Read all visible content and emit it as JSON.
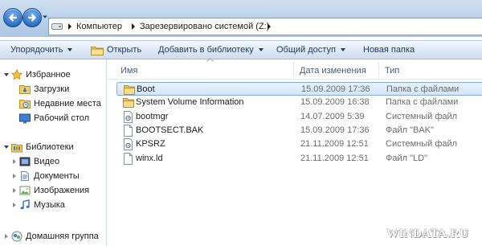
{
  "address_bar": {
    "crumbs": [
      "Компьютер",
      "Зарезервировано системой (Z:)"
    ]
  },
  "toolbar": {
    "organize": "Упорядочить",
    "open": "Открыть",
    "add_to_library": "Добавить в библиотеку",
    "share": "Общий доступ",
    "new_folder": "Новая папка"
  },
  "navpane": {
    "favorites": {
      "label": "Избранное",
      "items": [
        "Загрузки",
        "Недавние места",
        "Рабочий стол"
      ]
    },
    "libraries": {
      "label": "Библиотеки",
      "items": [
        "Видео",
        "Документы",
        "Изображения",
        "Музыка"
      ]
    },
    "homegroup": "Домашняя группа"
  },
  "filelist": {
    "columns": [
      "Имя",
      "Дата изменения",
      "Тип"
    ],
    "rows": [
      {
        "name": "Boot",
        "date": "15.09.2009 17:36",
        "type": "Папка с файлами",
        "icon": "folder-icon",
        "selected": true
      },
      {
        "name": "System Volume Information",
        "date": "15.09.2009 16:38",
        "type": "Папка с файлами",
        "icon": "folder-icon",
        "selected": false
      },
      {
        "name": "bootmgr",
        "date": "14.07.2009 5:39",
        "type": "Системный файл",
        "icon": "system-file-icon",
        "selected": false
      },
      {
        "name": "BOOTSECT.BAK",
        "date": "15.09.2009 17:36",
        "type": "Файл \"BAK\"",
        "icon": "file-icon",
        "selected": false
      },
      {
        "name": "KPSRZ",
        "date": "21.11.2009 12:51",
        "type": "Системный файл",
        "icon": "system-file-icon",
        "selected": false
      },
      {
        "name": "winx.ld",
        "date": "21.11.2009 12:51",
        "type": "Файл \"LD\"",
        "icon": "file-icon",
        "selected": false
      }
    ]
  },
  "watermark": "WINDATA.RU",
  "colors": {
    "accent": "#3f8ee6",
    "selection_border": "#84acdd",
    "folder": "#e8c46b"
  }
}
